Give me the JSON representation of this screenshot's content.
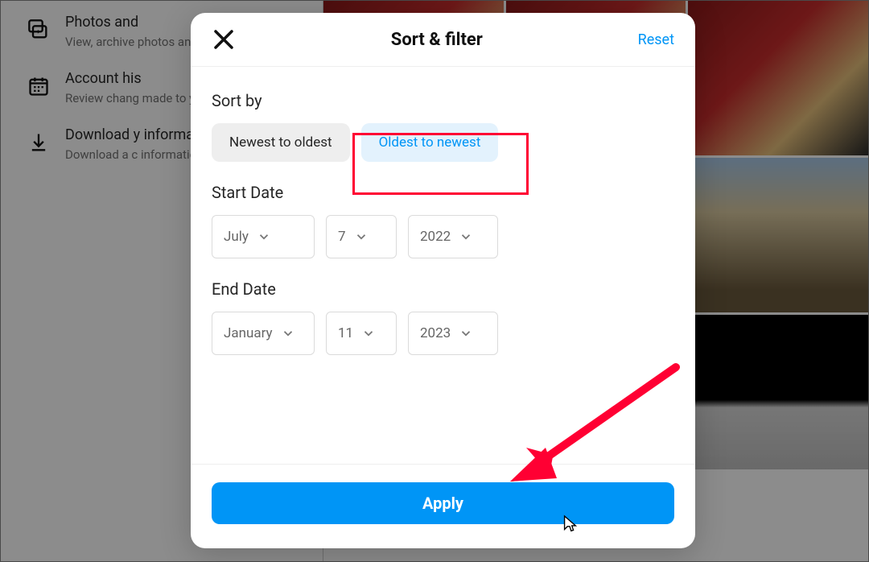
{
  "bg": {
    "items": [
      {
        "title": "Photos and",
        "desc": "View, archive photos and vi shared."
      },
      {
        "title": "Account his",
        "desc": "Review chang made to your since you crea"
      },
      {
        "title": "Download y information",
        "desc": "Download a c information y with Instagra"
      }
    ]
  },
  "modal": {
    "title": "Sort & filter",
    "reset": "Reset",
    "sort_label": "Sort by",
    "sort_options": {
      "newest": "Newest to oldest",
      "oldest": "Oldest to newest"
    },
    "start_date": {
      "label": "Start Date",
      "month": "July",
      "day": "7",
      "year": "2022"
    },
    "end_date": {
      "label": "End Date",
      "month": "January",
      "day": "11",
      "year": "2023"
    },
    "apply_label": "Apply"
  },
  "annotation": {
    "highlight": "red-box-oldest-to-newest",
    "arrow_target": "apply-button"
  }
}
